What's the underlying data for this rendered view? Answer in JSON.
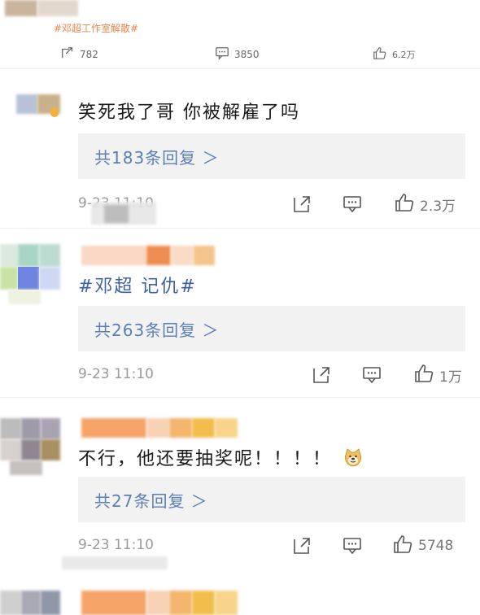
{
  "post": {
    "topic": "#邓超工作室解散#",
    "repost_count": "782",
    "comment_count": "3850",
    "like_count": "6.2万"
  },
  "comments": [
    {
      "text": "笑死我了哥 你被解雇了吗",
      "replies": "共183条回复 ＞",
      "time": "9-23 11:10",
      "likes": "2.3万"
    },
    {
      "text": "#邓超 记仇#",
      "replies": "共263条回复 ＞",
      "time": "9-23 11:10",
      "likes": "1万"
    },
    {
      "text": "不行，他还要抽奖呢！！！！",
      "emoji": "doge-emoji",
      "replies": "共27条回复 ＞",
      "time": "9-23 11:10",
      "likes": "5748"
    }
  ],
  "colors": {
    "topic": "#e5874d",
    "reply_link": "#5a7fb5",
    "reply_bg": "#f2f2f2",
    "meta": "#9a9a9a"
  },
  "icons": [
    "repost-icon",
    "comment-icon",
    "like-icon",
    "doge-emoji"
  ]
}
